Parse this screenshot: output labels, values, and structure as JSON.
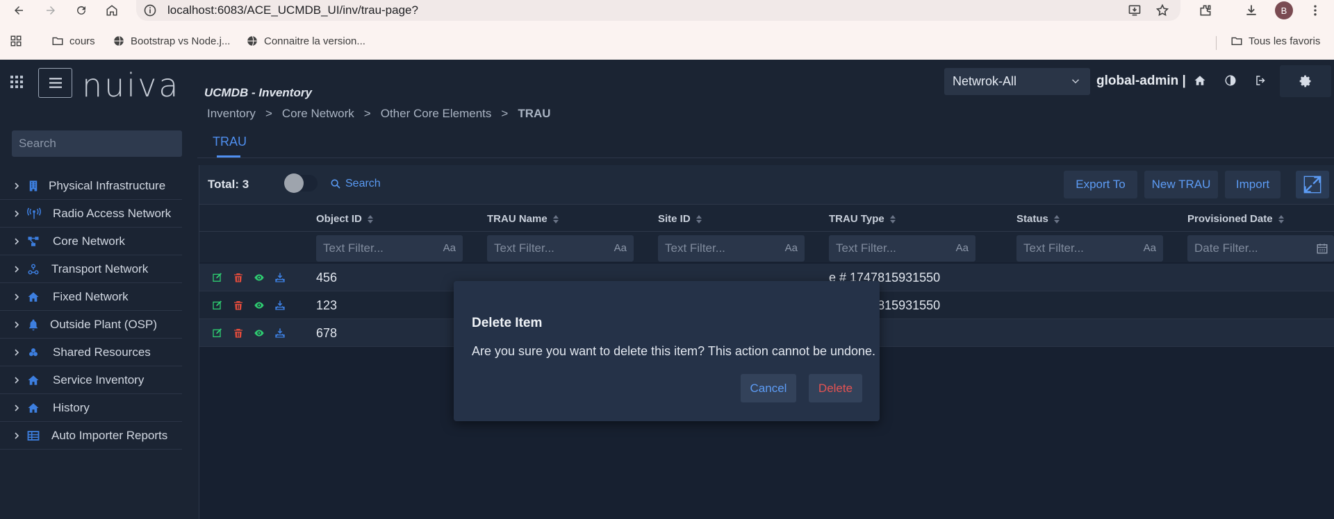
{
  "browser": {
    "url": "localhost:6083/ACE_UCMDB_UI/inv/trau-page?",
    "avatar_letter": "B",
    "bookmarks": [
      "cours",
      "Bootstrap vs Node.j...",
      "Connaitre la version..."
    ],
    "all_bookmarks": "Tous les favoris"
  },
  "header": {
    "logo": "nuiva",
    "app_title": "UCMDB - Inventory",
    "network_select": "Netwrok-All",
    "user": "global-admin |"
  },
  "sidebar": {
    "search_placeholder": "Search",
    "items": [
      {
        "label": "Physical Infrastructure",
        "icon": "building-icon"
      },
      {
        "label": "Radio Access Network",
        "icon": "antenna-icon"
      },
      {
        "label": "Core Network",
        "icon": "network-icon"
      },
      {
        "label": "Transport Network",
        "icon": "transport-icon"
      },
      {
        "label": "Fixed Network",
        "icon": "home-icon"
      },
      {
        "label": "Outside Plant (OSP)",
        "icon": "bell-icon"
      },
      {
        "label": "Shared Resources",
        "icon": "shared-icon"
      },
      {
        "label": "Service Inventory",
        "icon": "home-icon"
      },
      {
        "label": "History",
        "icon": "home-icon"
      },
      {
        "label": "Auto Importer Reports",
        "icon": "table-icon"
      }
    ]
  },
  "breadcrumb": {
    "items": [
      "Inventory",
      "Core Network",
      "Other Core Elements",
      "TRAU"
    ],
    "separator": ">"
  },
  "tab": "TRAU",
  "toolbar": {
    "total": "Total: 3",
    "search": "Search",
    "export": "Export To",
    "new": "New TRAU",
    "import": "Import"
  },
  "columns": [
    "Object ID",
    "TRAU Name",
    "Site ID",
    "TRAU Type",
    "Status",
    "Provisioned Date"
  ],
  "filters": {
    "text": "Text Filter...",
    "date": "Date Filter...",
    "aa": "Aa"
  },
  "rows": [
    {
      "object_id": "456",
      "trau_type": "e # 1747815931550"
    },
    {
      "object_id": "123",
      "trau_type": "e # 1747815931550"
    },
    {
      "object_id": "678",
      "trau_type": ""
    }
  ],
  "dialog": {
    "title": "Delete Item",
    "message": "Are you sure you want to delete this item? This action cannot be undone.",
    "cancel": "Cancel",
    "delete": "Delete"
  },
  "colors": {
    "accent": "#4f8ff0",
    "danger": "#e55353",
    "edit_green": "#2ecc71",
    "view_green": "#2ecc71",
    "delete_red": "#e74c3c"
  }
}
